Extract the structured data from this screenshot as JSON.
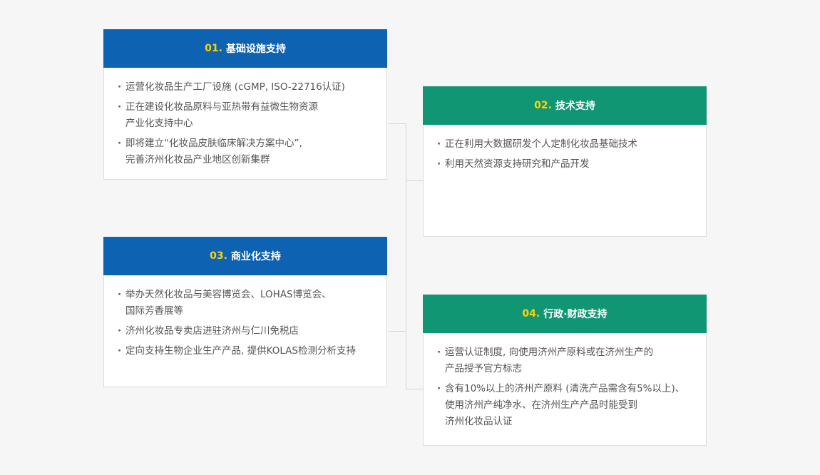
{
  "colors": {
    "blue_header": "#0e62b2",
    "green_header": "#119674",
    "number_accent": "#ffd200",
    "line": "#d5d5d5"
  },
  "cards": [
    {
      "num": "01.",
      "title": "基础设施支持",
      "items": [
        "运营化妆品生产工厂设施 (cGMP, ISO-22716认证)",
        "正在建设化妆品原料与亚热带有益微生物资源\n产业化支持中心",
        "即将建立“化妆品皮肤临床解决方案中心”,\n完善济州化妆品产业地区创新集群"
      ]
    },
    {
      "num": "02.",
      "title": "技术支持",
      "items": [
        "正在利用大数据研发个人定制化妆品基础技术",
        "利用天然资源支持研究和产品开发"
      ]
    },
    {
      "num": "03.",
      "title": "商业化支持",
      "items": [
        "举办天然化妆品与美容博览会、LOHAS博览会、\n国际芳香展等",
        "济州化妆品专卖店进驻济州与仁川免税店",
        "定向支持生物企业生产产品, 提供KOLAS检测分析支持"
      ]
    },
    {
      "num": "04.",
      "title": "行政·财政支持",
      "items": [
        "运营认证制度, 向使用济州产原料或在济州生产的\n产品授予官方标志",
        "含有10%以上的济州产原料 (清洗产品需含有5%以上)、\n使用济州产纯净水、在济州生产产品时能受到\n济州化妆品认证"
      ]
    }
  ]
}
